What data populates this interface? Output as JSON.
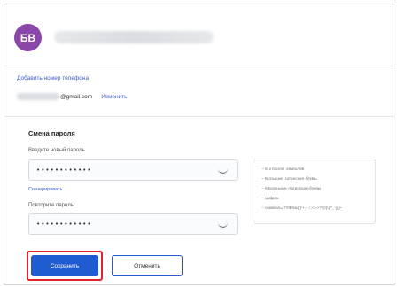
{
  "profile": {
    "avatar_initials": "БВ"
  },
  "contact": {
    "add_phone_label": "Добавить номер телефона",
    "email_domain": "@gmail.com",
    "change_label": "Изменить"
  },
  "password_form": {
    "title": "Смена пароля",
    "new_password_label": "Введите новый пароль",
    "new_password_value": "••••••••••••",
    "generate_label": "Сгенерировать",
    "repeat_password_label": "Повторите пароль",
    "repeat_password_value": "••••••••••••",
    "requirements": [
      "– 8 и более символов",
      "– Большие латинские буквы",
      "– Маленькие латинские буквы",
      "– цифры",
      "– символы !\"#$%&()*+,-./:;<=>?@[\\]^_`{|}~"
    ]
  },
  "actions": {
    "save_label": "Сохранить",
    "cancel_label": "Отменить"
  },
  "colors": {
    "avatar_bg": "#8a46a8",
    "link": "#3a5fc8",
    "primary_button": "#1f5bd1",
    "highlight_border": "#e0242d"
  }
}
